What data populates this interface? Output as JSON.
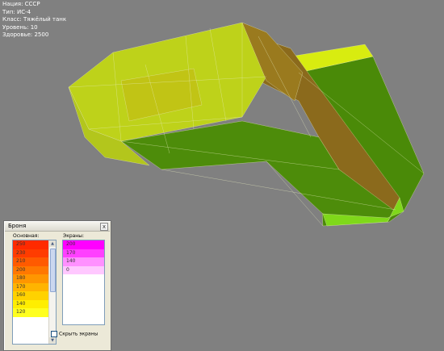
{
  "info": {
    "lines": [
      "Нация: СССР",
      "Тип: ИС-4",
      "Класс: Тяжёлый танк",
      "Уровень: 10",
      "Здоровье: 2500"
    ]
  },
  "armor_panel": {
    "title": "Броня",
    "close_label": "x",
    "base_label": "Основная:",
    "screens_label": "Экраны:",
    "base_values": [
      "250",
      "230",
      "210",
      "200",
      "180",
      "170",
      "160",
      "140",
      "120"
    ],
    "base_colors": [
      "#ff2a00",
      "#ff3c00",
      "#ff5a00",
      "#ff7800",
      "#ff9600",
      "#ffb400",
      "#ffd200",
      "#ffee00",
      "#ffff20"
    ],
    "screens_values": [
      "200",
      "170",
      "140",
      "0"
    ],
    "screens_colors": [
      "#ff00ff",
      "#ff40ff",
      "#ff90ff",
      "#ffc8ff"
    ],
    "hide_screens_label": "Скрыть экраны",
    "hide_screens_checked": false
  },
  "colors": {
    "background": "#808080",
    "hull_yellow": "#c8dc20",
    "hull_green": "#4f8a0a",
    "hull_brown": "#8b6a18"
  }
}
